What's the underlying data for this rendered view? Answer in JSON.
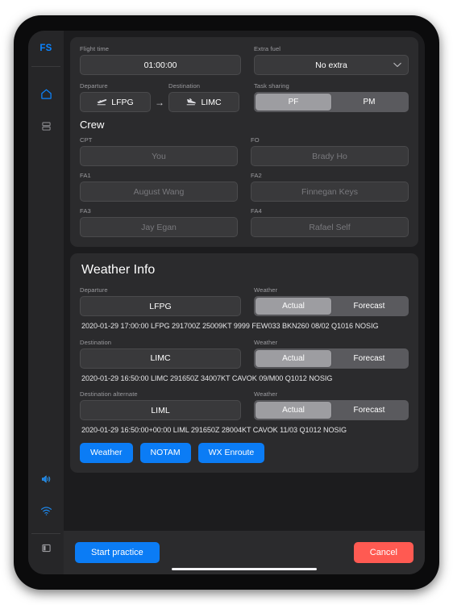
{
  "sidebar": {
    "brand": "FS",
    "items": [
      {
        "name": "home-icon",
        "label": "Home"
      },
      {
        "name": "library-icon",
        "label": "Library"
      }
    ],
    "bottom_items": [
      {
        "name": "volume-icon",
        "label": "Volume"
      },
      {
        "name": "wifi-icon",
        "label": "Wi-Fi"
      },
      {
        "name": "panel-toggle-icon",
        "label": "Toggle panel"
      }
    ]
  },
  "flight": {
    "flight_time_label": "Flight time",
    "flight_time_value": "01:00:00",
    "extra_fuel_label": "Extra fuel",
    "extra_fuel_value": "No extra",
    "departure_label": "Departure",
    "departure_value": "LFPG",
    "arrow": "→",
    "destination_label": "Destination",
    "destination_value": "LIMC",
    "task_sharing_label": "Task sharing",
    "task_sharing_options": [
      "PF",
      "PM"
    ],
    "task_sharing_selected": "PF"
  },
  "crew": {
    "title": "Crew",
    "members": [
      {
        "role": "CPT",
        "name": "You"
      },
      {
        "role": "FO",
        "name": "Brady Ho"
      },
      {
        "role": "FA1",
        "name": "August Wang"
      },
      {
        "role": "FA2",
        "name": "Finnegan Keys"
      },
      {
        "role": "FA3",
        "name": "Jay Egan"
      },
      {
        "role": "FA4",
        "name": "Rafael Self"
      }
    ]
  },
  "weather": {
    "title": "Weather Info",
    "weather_label": "Weather",
    "options": [
      "Actual",
      "Forecast"
    ],
    "entries": [
      {
        "label": "Departure",
        "icao": "LFPG",
        "selected": "Actual",
        "metar": "2020-01-29 17:00:00  LFPG 291700Z 25009KT 9999 FEW033 BKN260 08/02 Q1016 NOSIG"
      },
      {
        "label": "Destination",
        "icao": "LIMC",
        "selected": "Actual",
        "metar": "2020-01-29 16:50:00  LIMC 291650Z 34007KT CAVOK 09/M00 Q1012 NOSIG"
      },
      {
        "label": "Destination alternate",
        "icao": "LIML",
        "selected": "Actual",
        "metar": "2020-01-29 16:50:00+00:00  LIML 291650Z 28004KT CAVOK 11/03 Q1012 NOSIG"
      }
    ],
    "actions": [
      "Weather",
      "NOTAM",
      "WX Enroute"
    ]
  },
  "footer": {
    "start_label": "Start practice",
    "cancel_label": "Cancel"
  },
  "colors": {
    "accent_blue": "#0b7cf5",
    "brand_blue": "#0b84ff",
    "danger_red": "#ff5a52",
    "panel_bg": "#2b2b2d",
    "screen_bg": "#1c1c1e",
    "field_bg": "#39393b",
    "segment_on": "#9d9da1"
  }
}
